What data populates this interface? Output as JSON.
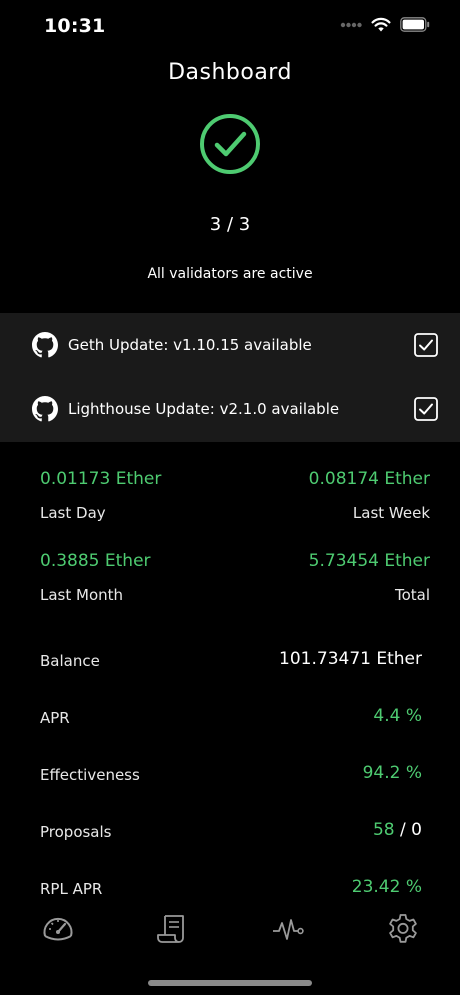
{
  "status_bar": {
    "time": "10:31"
  },
  "header": {
    "title": "Dashboard",
    "validators_count": "3 / 3",
    "validators_status": "All validators are active"
  },
  "updates": [
    {
      "icon": "github-icon",
      "label": "Geth Update: v1.10.15 available",
      "checked": true
    },
    {
      "icon": "github-icon",
      "label": "Lighthouse Update: v2.1.0 available",
      "checked": true
    }
  ],
  "earnings": {
    "last_day": {
      "value": "0.01173 Ether",
      "label": "Last Day"
    },
    "last_week": {
      "value": "0.08174 Ether",
      "label": "Last Week"
    },
    "last_month": {
      "value": "0.3885 Ether",
      "label": "Last Month"
    },
    "total": {
      "value": "5.73454 Ether",
      "label": "Total"
    }
  },
  "stats": {
    "balance": {
      "label": "Balance",
      "value": "101.73471 Ether"
    },
    "apr": {
      "label": "APR",
      "value": "4.4 %"
    },
    "effectiveness": {
      "label": "Effectiveness",
      "value": "94.2 %"
    },
    "proposals": {
      "label": "Proposals",
      "value_success": "58",
      "separator": " / ",
      "value_missed": "0"
    },
    "rpl_apr": {
      "label": "RPL APR",
      "value": "23.42 %"
    }
  },
  "tabs": [
    "dashboard-icon",
    "receipt-icon",
    "activity-icon",
    "settings-icon"
  ],
  "colors": {
    "accent_green": "#4ecb71",
    "background": "#000000",
    "panel": "#1a1a1a"
  }
}
